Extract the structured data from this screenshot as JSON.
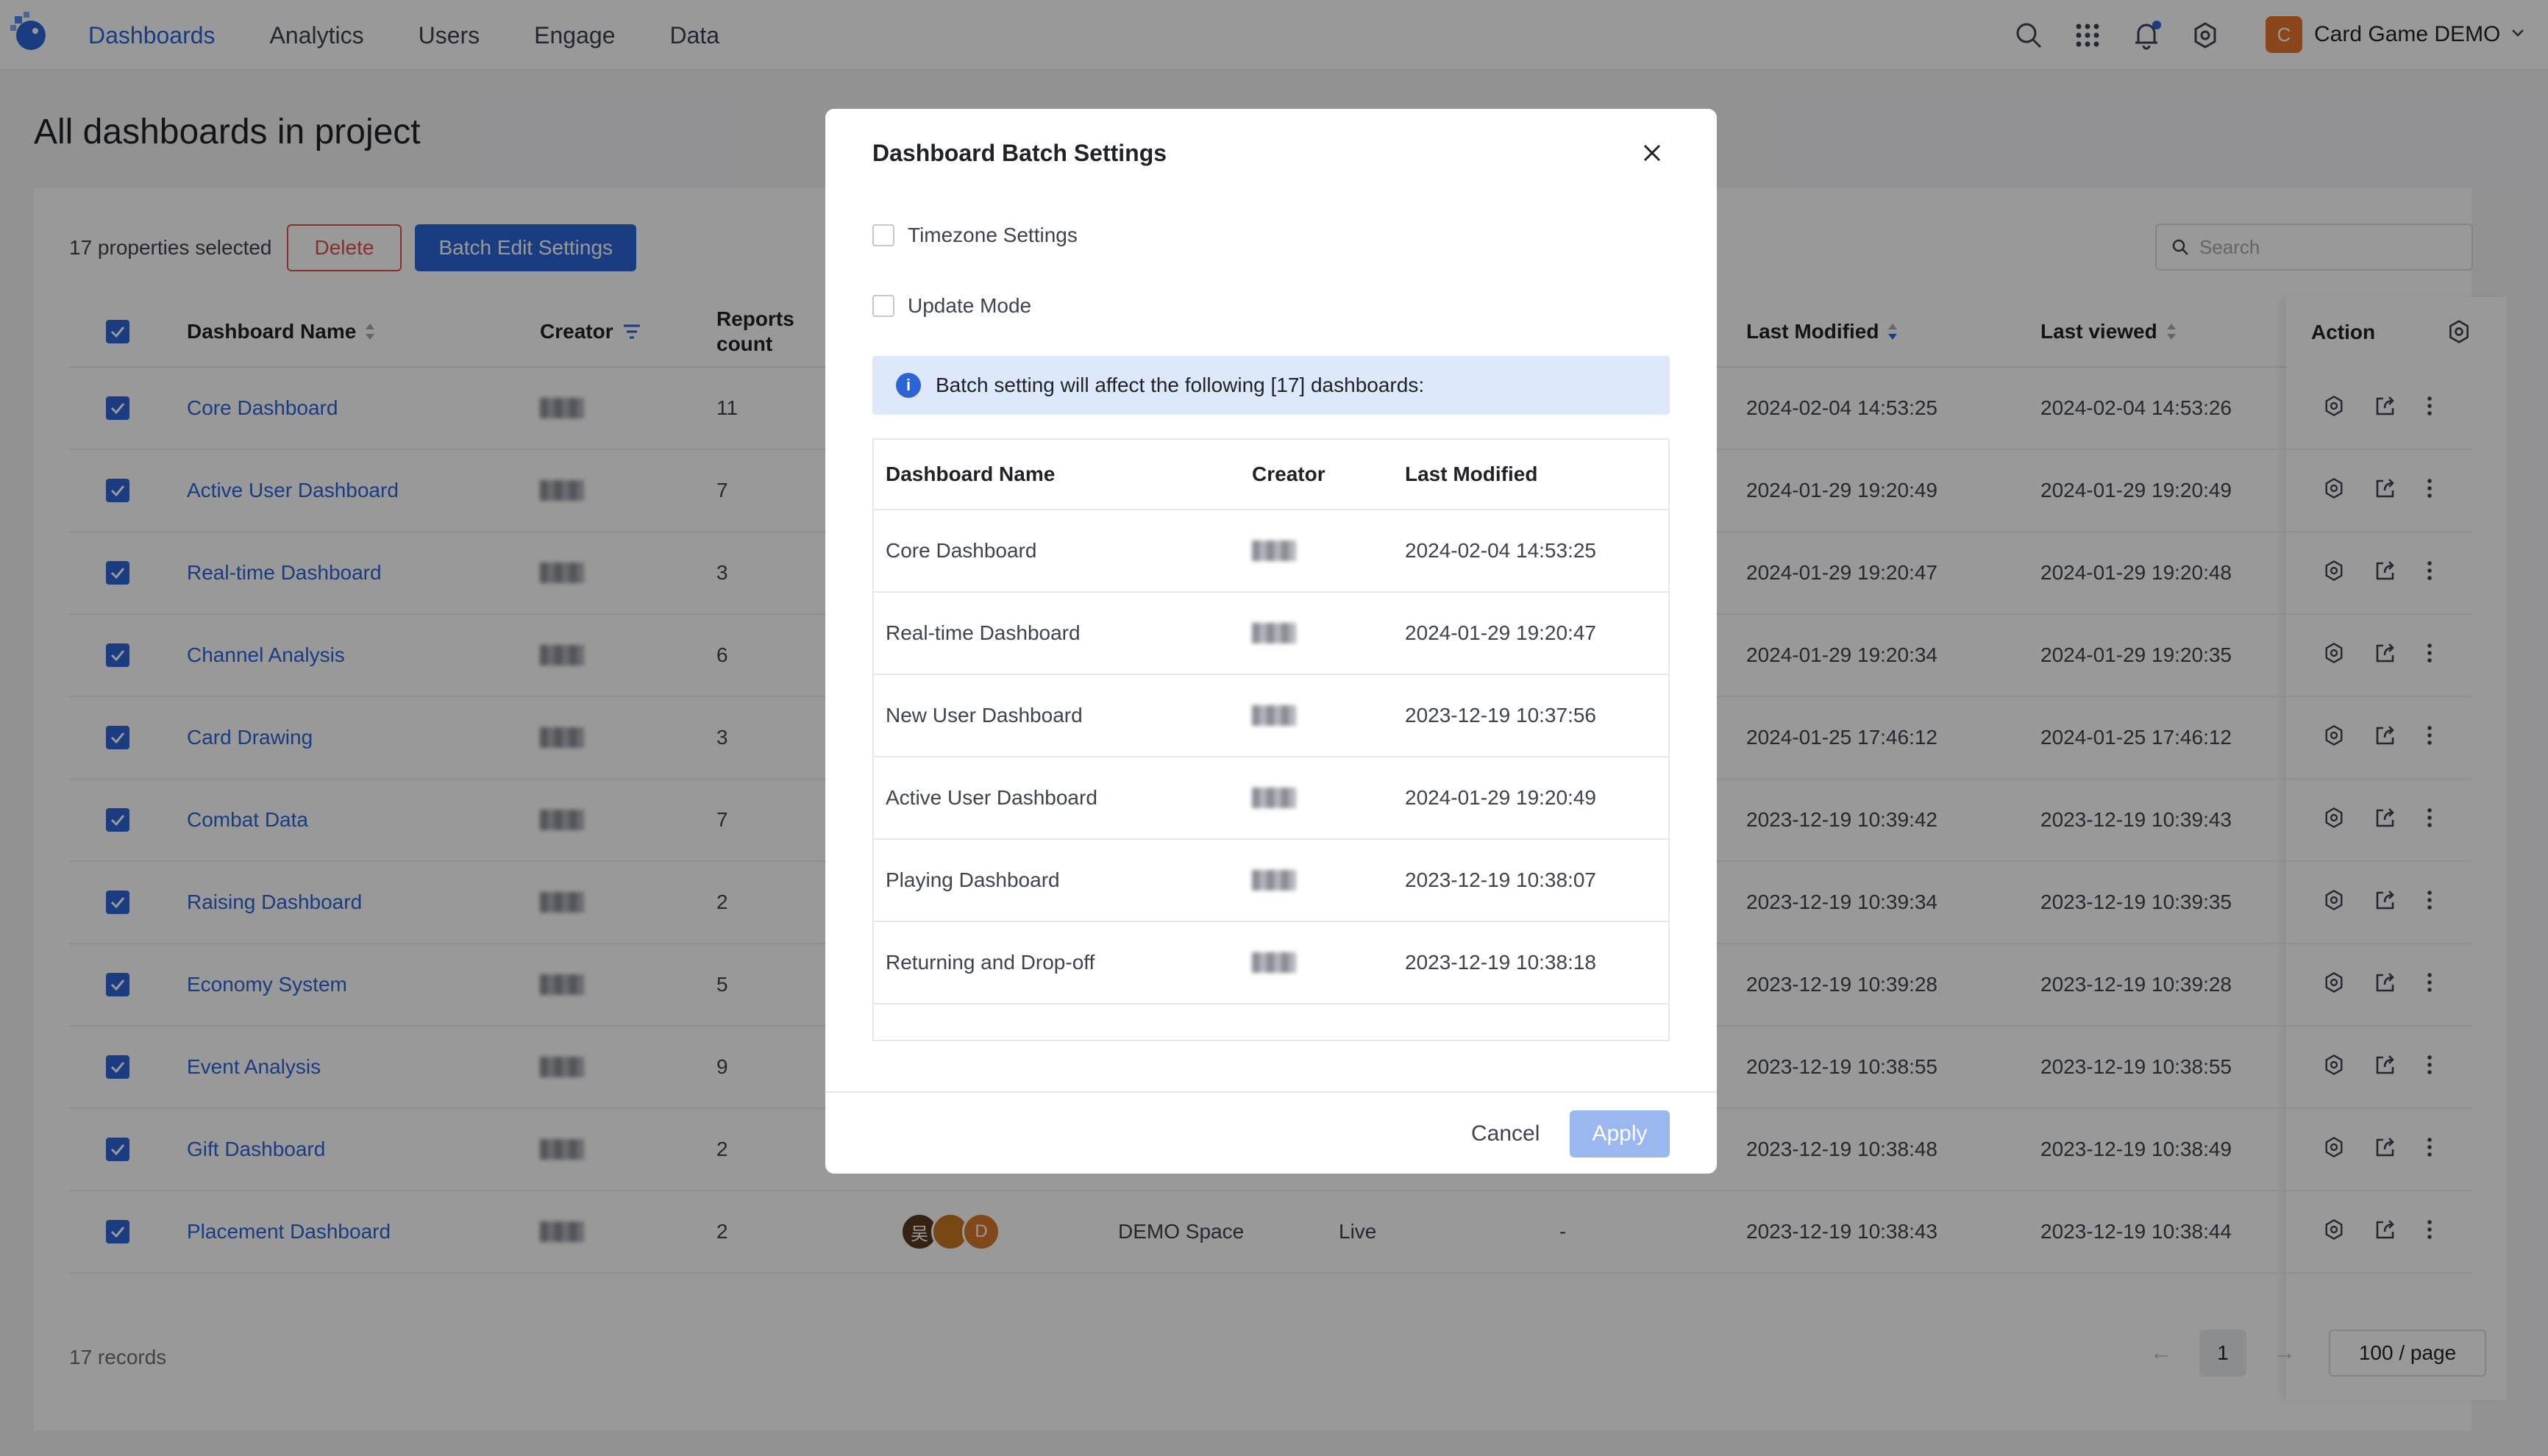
{
  "nav": {
    "items": [
      "Dashboards",
      "Analytics",
      "Users",
      "Engage",
      "Data"
    ],
    "active_index": 0,
    "account_initial": "C",
    "account_name": "Card Game DEMO"
  },
  "page": {
    "title": "All dashboards in project",
    "selected_text": "17 properties selected",
    "delete_label": "Delete",
    "batch_edit_label": "Batch Edit Settings",
    "search_placeholder": "Search",
    "records_text": "17 records",
    "page_number": "1",
    "page_size": "100 / page"
  },
  "table": {
    "headers": {
      "name": "Dashboard Name",
      "creator": "Creator",
      "reports": "Reports count",
      "last_modified": "Last Modified",
      "last_viewed": "Last viewed",
      "action": "Action"
    },
    "rows": [
      {
        "name": "Core Dashboard",
        "reports": "11",
        "modified": "2024-02-04 14:53:25",
        "viewed": "2024-02-04 14:53:26"
      },
      {
        "name": "Active User Dashboard",
        "reports": "7",
        "modified": "2024-01-29 19:20:49",
        "viewed": "2024-01-29 19:20:49"
      },
      {
        "name": "Real-time Dashboard",
        "reports": "3",
        "modified": "2024-01-29 19:20:47",
        "viewed": "2024-01-29 19:20:48"
      },
      {
        "name": "Channel Analysis",
        "reports": "6",
        "modified": "2024-01-29 19:20:34",
        "viewed": "2024-01-29 19:20:35"
      },
      {
        "name": "Card Drawing",
        "reports": "3",
        "modified": "2024-01-25 17:46:12",
        "viewed": "2024-01-25 17:46:12"
      },
      {
        "name": "Combat Data",
        "reports": "7",
        "modified": "2023-12-19 10:39:42",
        "viewed": "2023-12-19 10:39:43"
      },
      {
        "name": "Raising Dashboard",
        "reports": "2",
        "modified": "2023-12-19 10:39:34",
        "viewed": "2023-12-19 10:39:35"
      },
      {
        "name": "Economy System",
        "reports": "5",
        "modified": "2023-12-19 10:39:28",
        "viewed": "2023-12-19 10:39:28"
      },
      {
        "name": "Event Analysis",
        "reports": "9",
        "modified": "2023-12-19 10:38:55",
        "viewed": "2023-12-19 10:38:55"
      },
      {
        "name": "Gift Dashboard",
        "reports": "2",
        "modified": "2023-12-19 10:38:48",
        "viewed": "2023-12-19 10:38:49"
      },
      {
        "name": "Placement Dashboard",
        "reports": "2",
        "modified": "2023-12-19 10:38:43",
        "viewed": "2023-12-19 10:38:44",
        "space": "DEMO Space",
        "mode": "Live",
        "tz": "-",
        "avatars": [
          "吴",
          "",
          "D"
        ]
      }
    ]
  },
  "modal": {
    "title": "Dashboard Batch Settings",
    "option_timezone": "Timezone Settings",
    "option_update": "Update Mode",
    "info_text": "Batch setting will affect the following [17] dashboards:",
    "headers": {
      "name": "Dashboard Name",
      "creator": "Creator",
      "modified": "Last Modified"
    },
    "rows": [
      {
        "name": "Core Dashboard",
        "modified": "2024-02-04 14:53:25"
      },
      {
        "name": "Real-time Dashboard",
        "modified": "2024-01-29 19:20:47"
      },
      {
        "name": "New User Dashboard",
        "modified": "2023-12-19 10:37:56"
      },
      {
        "name": "Active User Dashboard",
        "modified": "2024-01-29 19:20:49"
      },
      {
        "name": "Playing Dashboard",
        "modified": "2023-12-19 10:38:07"
      },
      {
        "name": "Returning and Drop-off",
        "modified": "2023-12-19 10:38:18"
      }
    ],
    "cancel_label": "Cancel",
    "apply_label": "Apply"
  },
  "colors": {
    "accent": "#2c64d6",
    "danger": "#e0534a",
    "apply_disabled": "#9bb7ef"
  }
}
